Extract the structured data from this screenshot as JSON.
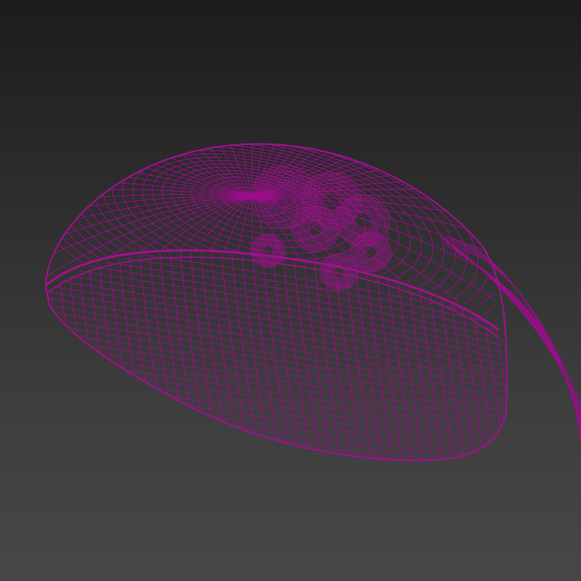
{
  "viewport": {
    "view_mode": "wireframe",
    "background": {
      "top": "#1c1c1c",
      "bottom": "#474747"
    },
    "wire_color": "#9a0d8c"
  },
  "scene": {
    "objects": [
      {
        "name": "lamp-shade",
        "type": "hemisphere-mesh"
      },
      {
        "name": "lamp-bulb-fixture",
        "type": "mesh-cluster"
      },
      {
        "name": "lamp-arm",
        "type": "curved-tube-mesh"
      }
    ]
  }
}
